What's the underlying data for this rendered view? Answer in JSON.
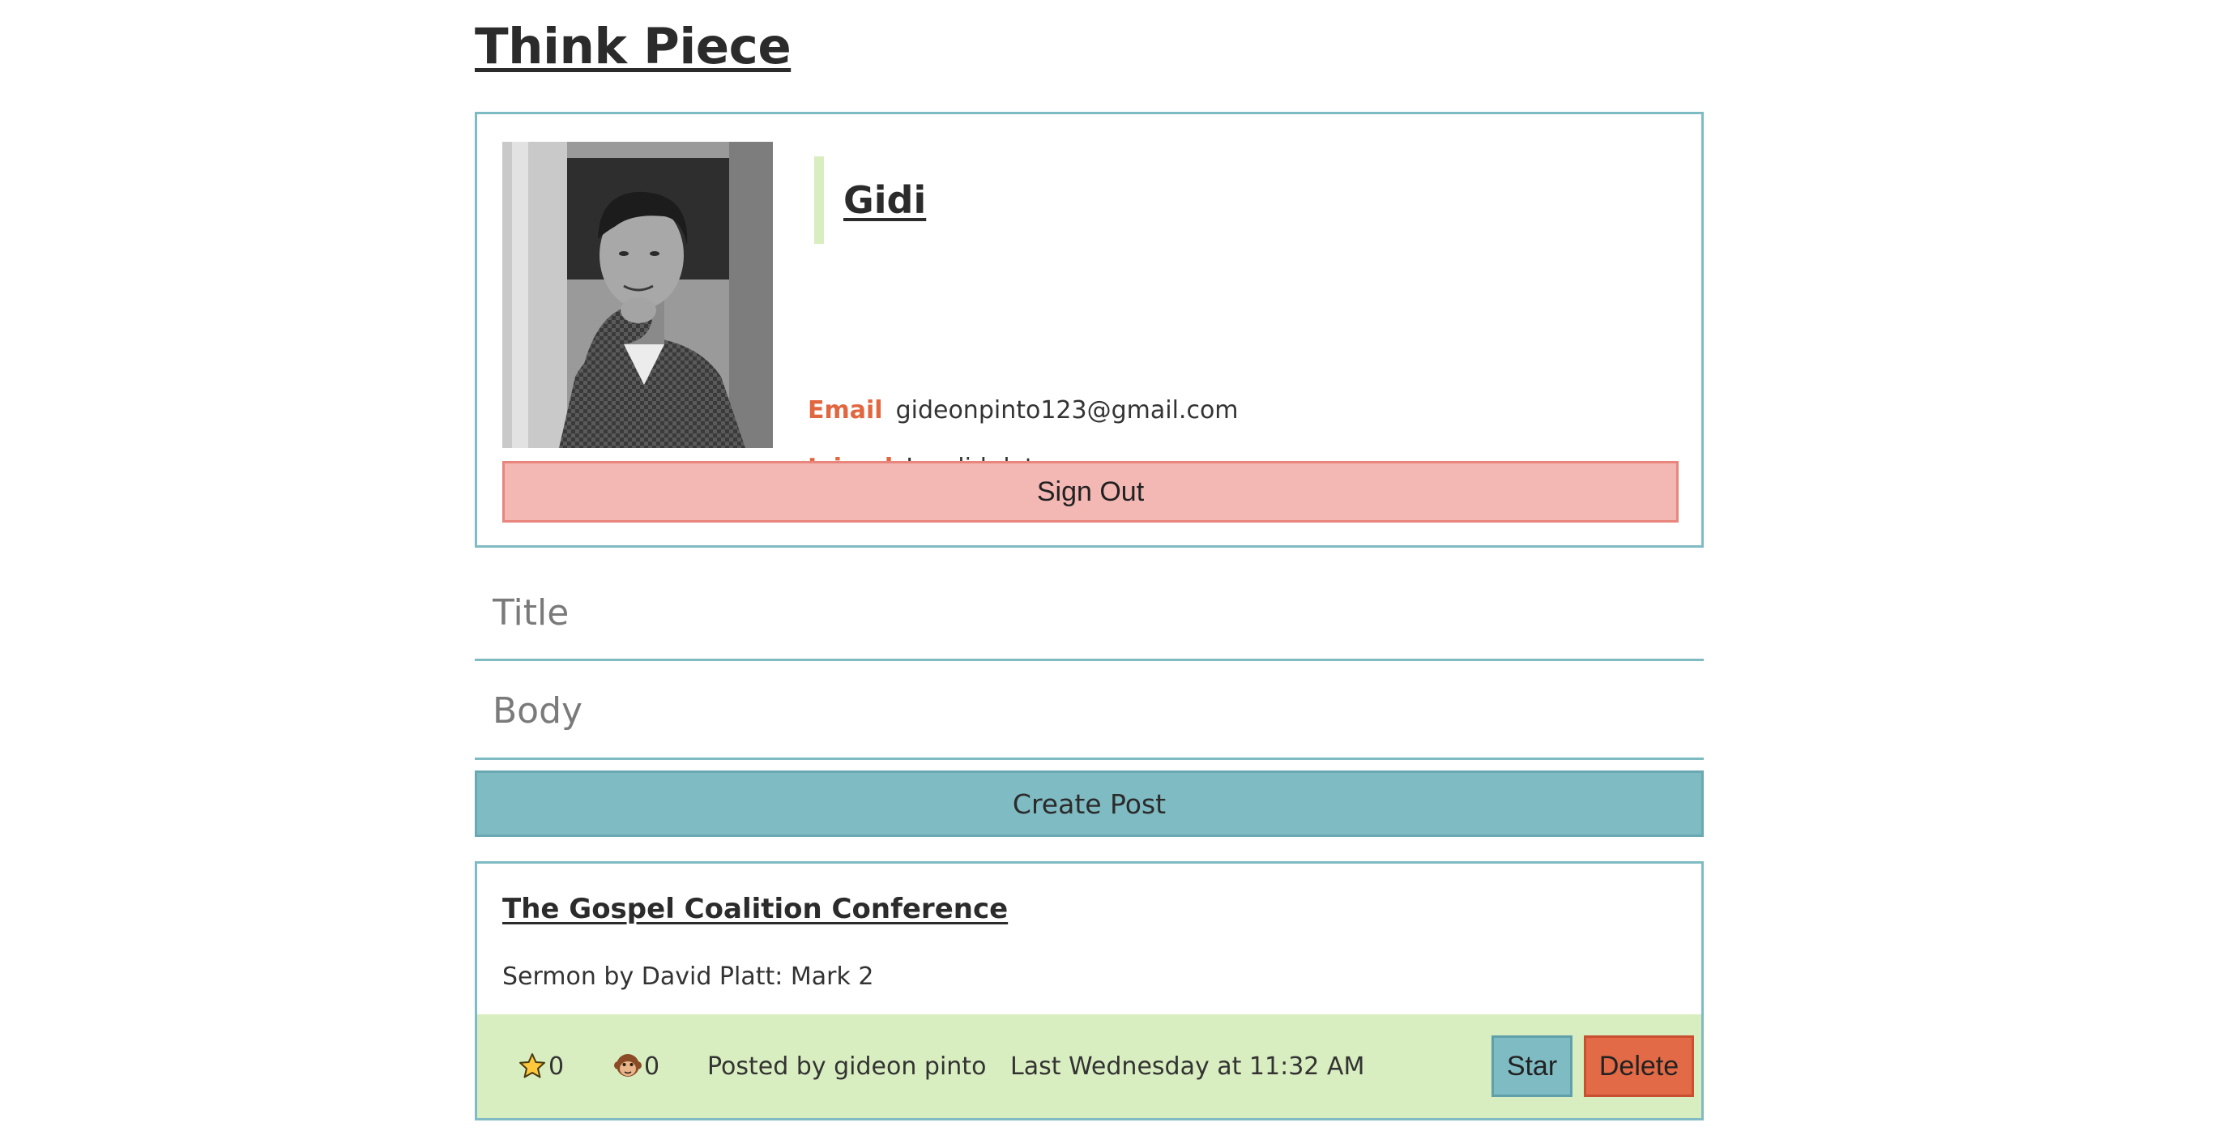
{
  "app": {
    "title": "Think Piece"
  },
  "profile": {
    "name": "Gidi",
    "email_label": "Email",
    "email": "gideonpinto123@gmail.com",
    "joined_label": "Joined",
    "joined": "Invalid date",
    "sign_out_label": "Sign Out",
    "avatar_icon": "user-photo"
  },
  "form": {
    "title_placeholder": "Title",
    "title_value": "",
    "body_placeholder": "Body",
    "body_value": "",
    "submit_label": "Create Post"
  },
  "posts": [
    {
      "title": "The Gospel Coalition Conference",
      "body": "Sermon by David Platt: Mark 2",
      "stars_icon": "star-icon",
      "stars": "0",
      "comments_icon": "monkey-icon",
      "comments": "0",
      "author": "Posted by gideon pinto",
      "time": "Last Wednesday at 11:32 AM",
      "star_label": "Star",
      "delete_label": "Delete"
    }
  ],
  "colors": {
    "accent_teal": "#7fbbc3",
    "accent_green": "#d9eec0",
    "label_orange": "#e0673f",
    "signout_pink": "#f4b8b4",
    "delete_red": "#e36a47"
  }
}
